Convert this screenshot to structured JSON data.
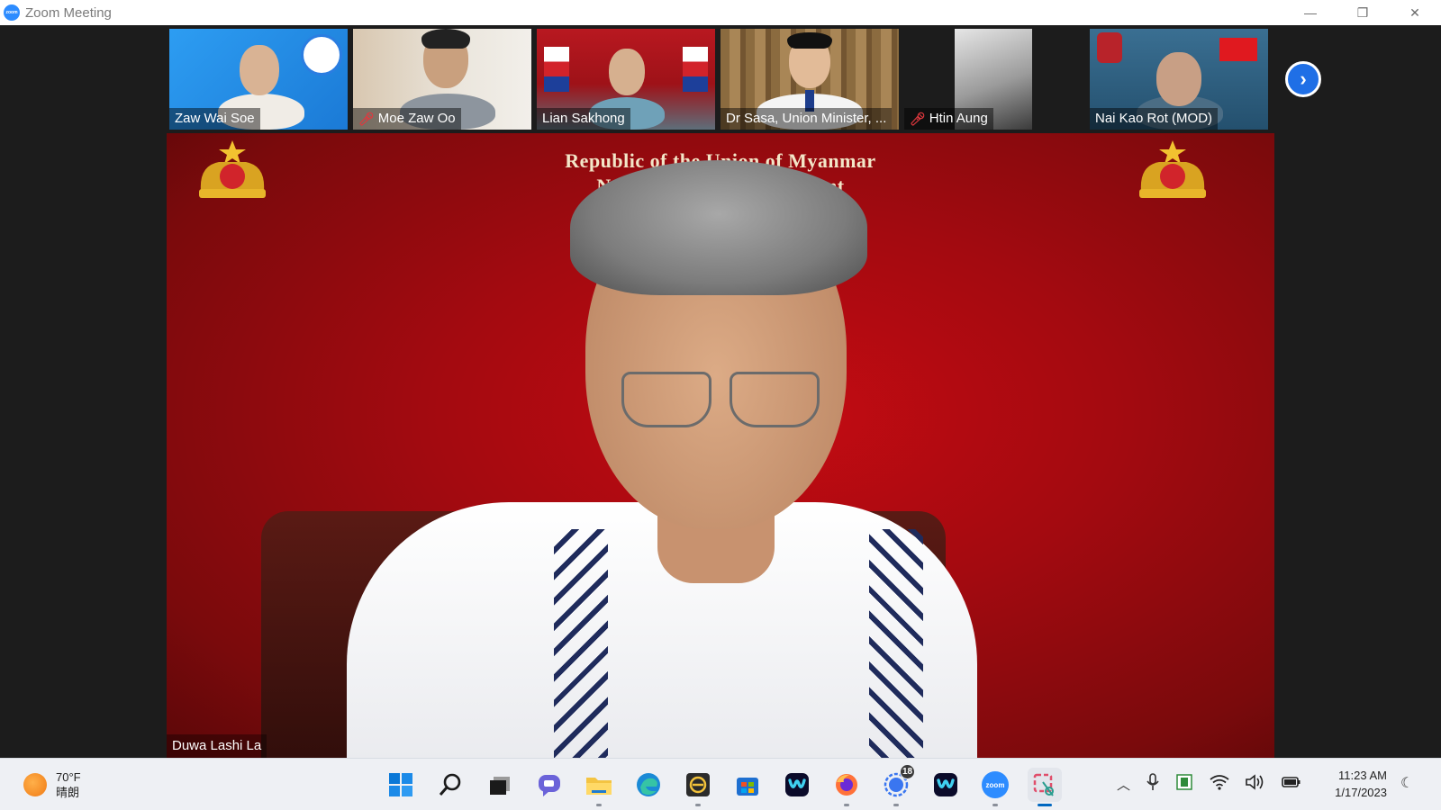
{
  "window": {
    "title": "Zoom Meeting",
    "app_icon_label": "zoom",
    "minimize": "—",
    "restore": "❐",
    "close": "✕"
  },
  "participants": [
    {
      "name": "Zaw Wai Soe",
      "muted": false
    },
    {
      "name": "Moe Zaw Oo",
      "muted": true
    },
    {
      "name": "Lian Sakhong",
      "muted": false
    },
    {
      "name": "Dr Sasa, Union Minister, ...",
      "muted": false
    },
    {
      "name": "Htin Aung",
      "muted": true
    },
    {
      "name": "Nai Kao Rot (MOD)",
      "muted": false
    }
  ],
  "next_page_icon": "chevron-right-icon",
  "main_video": {
    "banner_line1": "Republic of the Union of Myanmar",
    "banner_line2": "National Unity Government",
    "speaker_name": "Duwa Lashi La",
    "background_color": "#b30a10"
  },
  "taskbar": {
    "weather_temp": "70°F",
    "weather_desc": "晴朗",
    "apps": [
      {
        "icon": "windows-start-icon"
      },
      {
        "icon": "search-icon"
      },
      {
        "icon": "task-view-icon"
      },
      {
        "icon": "chat-icon"
      },
      {
        "icon": "file-explorer-icon"
      },
      {
        "icon": "edge-icon"
      },
      {
        "icon": "app-icon"
      },
      {
        "icon": "microsoft-store-icon"
      },
      {
        "icon": "webex-icon"
      },
      {
        "icon": "firefox-icon"
      },
      {
        "icon": "signal-icon",
        "badge": "18"
      },
      {
        "icon": "webex-icon"
      },
      {
        "icon": "zoom-icon",
        "label": "zoom"
      },
      {
        "icon": "snipping-tool-icon"
      }
    ],
    "time": "11:23 AM",
    "date": "1/17/2023"
  }
}
